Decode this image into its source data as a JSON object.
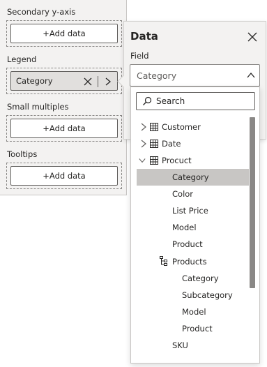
{
  "wells": {
    "secondary_y": {
      "label": "Secondary y-axis",
      "button": "+Add data"
    },
    "legend": {
      "label": "Legend",
      "chip": "Category"
    },
    "small_multiples": {
      "label": "Small multiples",
      "button": "+Add data"
    },
    "tooltips": {
      "label": "Tooltips",
      "button": "+Add data"
    }
  },
  "flyout": {
    "title": "Data",
    "field_label": "Field",
    "field_value": "Category",
    "search_placeholder": "Search",
    "tree": {
      "customer": "Customer",
      "date": "Date",
      "product": "Procuct",
      "product_fields": {
        "category": "Category",
        "color": "Color",
        "list_price": "List Price",
        "model": "Model",
        "product": "Product"
      },
      "hierarchy": "Products",
      "hierarchy_levels": {
        "category": "Category",
        "subcategory": "Subcategory",
        "model": "Model",
        "product": "Product"
      },
      "sku": "SKU"
    }
  },
  "colors": {
    "selected_row": "#c8c6c4",
    "panel_bg": "#f3f2f1",
    "border": "#605e5c"
  },
  "icons": [
    "close-icon",
    "chevron-right-icon",
    "caret-up-icon",
    "search-icon",
    "table-icon",
    "hierarchy-icon"
  ]
}
